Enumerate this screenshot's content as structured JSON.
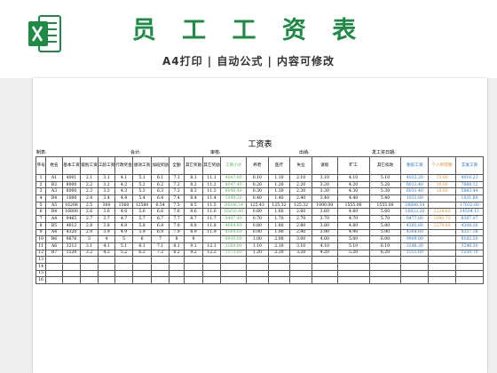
{
  "banner": {
    "title": "员 工 工 资 表",
    "subtitle": "A4打印 | 自动公式 | 内容可修改",
    "title_color": "#1f8a45"
  },
  "sheet": {
    "title": "工资表",
    "meta": {
      "unit_label": "制表:",
      "accountant_label": "会计:",
      "reviewer_label": "审核:",
      "cashier_label": "出纳:",
      "paydate_label": "发工资日期:"
    },
    "columns": [
      "序号",
      "姓名",
      "基本工资",
      "级别工资",
      "工龄工资",
      "行政奖金",
      "绩效工资",
      "加班奖励",
      "全勤",
      "其它奖励",
      "其它奖励",
      "工资小计",
      "养老",
      "医疗",
      "失业",
      "请假",
      "旷工",
      "其它扣款",
      "税前工资",
      "个人所得税",
      "实发工资"
    ],
    "rows": [
      [
        "1",
        "A1",
        "4001",
        "2.1",
        "3.1",
        "4.1",
        "5.1",
        "6.1",
        "7.1",
        "8.1",
        "11.1",
        "4047.80",
        "0.10",
        "1.10",
        "2.10",
        "3.10",
        "4.10",
        "5.10",
        "4032.20",
        "15.60",
        "4016.23"
      ],
      [
        "2",
        "B2",
        "8000",
        "2.2",
        "3.2",
        "4.2",
        "5.2",
        "6.2",
        "7.2",
        "8.2",
        "11.2",
        "8047.40",
        "0.20",
        "1.20",
        "2.20",
        "3.20",
        "4.20",
        "5.20",
        "8031.40",
        "16.00",
        "7888.12"
      ],
      [
        "3",
        "A3",
        "8000",
        "2.3",
        "3.3",
        "4.3",
        "5.3",
        "6.3",
        "7.3",
        "8.3",
        "11.3",
        "8048.40",
        "0.30",
        "1.30",
        "2.30",
        "3.30",
        "4.30",
        "5.30",
        "6031.40",
        "18.60",
        "5883.44"
      ],
      [
        "4",
        "B4",
        "1000",
        "2.4",
        "3.4",
        "4.4",
        "5.4",
        "6.4",
        "7.4",
        "8.4",
        "11.4",
        "1049.20",
        "0.40",
        "1.40",
        "2.40",
        "3.40",
        "4.40",
        "5.40",
        "1031.80",
        "",
        "1031.80"
      ],
      [
        "5",
        "A5",
        "16208",
        "2.5",
        "300",
        "1560",
        "12580",
        "6.54",
        "7.5",
        "8.5",
        "11.5",
        "26606.54",
        "125.43",
        "125.32",
        "125.32",
        "1000.00",
        "1555.00",
        "1555.00",
        "26606.54",
        "",
        "17032.60"
      ],
      [
        "6",
        "B4",
        "16800",
        "2.6",
        "3.6",
        "4.6",
        "5.6",
        "6.6",
        "7.6",
        "8.6",
        "11.6",
        "16850.80",
        "0.60",
        "1.60",
        "2.60",
        "3.60",
        "4.60",
        "5.60",
        "16832.20",
        "2328.60",
        "14504.15"
      ],
      [
        "7",
        "A4",
        "9465",
        "2.7",
        "3.7",
        "4.7",
        "5.7",
        "6.7",
        "7.7",
        "8.7",
        "11.7",
        "9497.40",
        "0.70",
        "1.70",
        "2.70",
        "3.70",
        "4.70",
        "5.70",
        "9477.80",
        "1090.73",
        "8387.07"
      ],
      [
        "8",
        "B5",
        "4612",
        "2.8",
        "3.8",
        "4.8",
        "5.8",
        "6.8",
        "7.8",
        "8.8",
        "11.8",
        "4664.80",
        "0.80",
        "1.80",
        "2.80",
        "3.80",
        "4.80",
        "5.80",
        "4385.80",
        "2278.60",
        "4208.26"
      ],
      [
        "9",
        "A4",
        "4320",
        "2.9",
        "3.9",
        "4.9",
        "5.9",
        "6.9",
        "7.9",
        "8.9",
        "11.9",
        "4364.60",
        "0.90",
        "1.90",
        "2.90",
        "3.90",
        "4.90",
        "5.90",
        "4364.60",
        "",
        "4357.38"
      ],
      [
        "10",
        "B6",
        "9876",
        "3",
        "4",
        "5",
        "6",
        "7",
        "8",
        "9",
        "",
        "9930.00",
        "1.00",
        "2.00",
        "3.00",
        "4.00",
        "5.00",
        "6.00",
        "9909.00",
        "",
        "9182.20"
      ],
      [
        "11",
        "A6",
        "3213",
        "3.1",
        "4.1",
        "5.1",
        "6.1",
        "7.1",
        "8.1",
        "9.1",
        "12.1",
        "3269.80",
        "1.10",
        "2.10",
        "3.10",
        "4.10",
        "5.10",
        "6.10",
        "3248.30",
        "",
        "3248.30"
      ],
      [
        "12",
        "B7",
        "1520",
        "3.2",
        "4.2",
        "5.2",
        "6.2",
        "7.2",
        "8.2",
        "9.2",
        "12.2",
        "1573.60",
        "1.20",
        "2.20",
        "3.20",
        "4.20",
        "5.20",
        "6.20",
        "1551.60",
        "",
        "1550.70"
      ],
      [
        "13",
        "",
        "",
        "",
        "",
        "",
        "",
        "",
        "",
        "",
        "",
        "",
        "",
        "",
        "",
        "",
        "",
        "",
        "",
        "",
        ""
      ],
      [
        "14",
        "",
        "",
        "",
        "",
        "",
        "",
        "",
        "",
        "",
        "",
        "",
        "",
        "",
        "",
        "",
        "",
        "",
        "",
        "",
        ""
      ],
      [
        "15",
        "",
        "",
        "",
        "",
        "",
        "",
        "",
        "",
        "",
        "",
        "",
        "",
        "",
        "",
        "",
        "",
        "",
        "",
        "",
        ""
      ],
      [
        "16",
        "",
        "",
        "",
        "",
        "",
        "",
        "",
        "",
        "",
        "",
        "",
        "",
        "",
        "",
        "",
        "",
        "",
        "",
        "",
        ""
      ]
    ]
  }
}
